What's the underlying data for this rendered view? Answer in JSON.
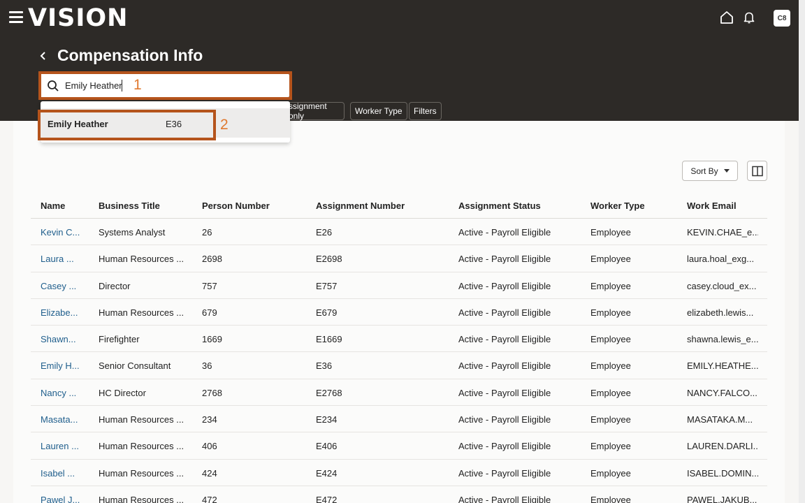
{
  "header": {
    "logo": "VISION",
    "avatar_initials": "C8",
    "page_title": "Compensation Info"
  },
  "search": {
    "value": "Emily Heather",
    "step_marker": "1"
  },
  "suggestion": {
    "name": "Emily Heather",
    "number": "E36",
    "step_marker": "2"
  },
  "filters": {
    "assignment_only": "ssignment only",
    "worker_type": "Worker Type",
    "filters": "Filters"
  },
  "toolbar": {
    "sort_by": "Sort By"
  },
  "table": {
    "columns": [
      "Name",
      "Business Title",
      "Person Number",
      "Assignment Number",
      "Assignment Status",
      "Worker Type",
      "Work Email"
    ],
    "rows": [
      [
        "Kevin C...",
        "Systems Analyst",
        "26",
        "E26",
        "Active - Payroll Eligible",
        "Employee",
        "KEVIN.CHAE_e..."
      ],
      [
        "Laura ...",
        "Human Resources ...",
        "2698",
        "E2698",
        "Active - Payroll Eligible",
        "Employee",
        "laura.hoal_exg..."
      ],
      [
        "Casey ...",
        "Director",
        "757",
        "E757",
        "Active - Payroll Eligible",
        "Employee",
        "casey.cloud_ex..."
      ],
      [
        "Elizabe...",
        "Human Resources ...",
        "679",
        "E679",
        "Active - Payroll Eligible",
        "Employee",
        "elizabeth.lewis..."
      ],
      [
        "Shawn...",
        "Firefighter",
        "1669",
        "E1669",
        "Active - Payroll Eligible",
        "Employee",
        "shawna.lewis_e..."
      ],
      [
        "Emily H...",
        "Senior Consultant",
        "36",
        "E36",
        "Active - Payroll Eligible",
        "Employee",
        "EMILY.HEATHE..."
      ],
      [
        "Nancy ...",
        "HC Director",
        "2768",
        "E2768",
        "Active - Payroll Eligible",
        "Employee",
        "NANCY.FALCO..."
      ],
      [
        "Masata...",
        "Human Resources ...",
        "234",
        "E234",
        "Active - Payroll Eligible",
        "Employee",
        "MASATAKA.M..."
      ],
      [
        "Lauren ...",
        "Human Resources ...",
        "406",
        "E406",
        "Active - Payroll Eligible",
        "Employee",
        "LAUREN.DARLI..."
      ],
      [
        "Isabel ...",
        "Human Resources ...",
        "424",
        "E424",
        "Active - Payroll Eligible",
        "Employee",
        "ISABEL.DOMIN..."
      ],
      [
        "Pawel J...",
        "Human Resources ...",
        "472",
        "E472",
        "Active - Payroll Eligible",
        "Employee",
        "PAWEL.JAKUB..."
      ]
    ]
  }
}
